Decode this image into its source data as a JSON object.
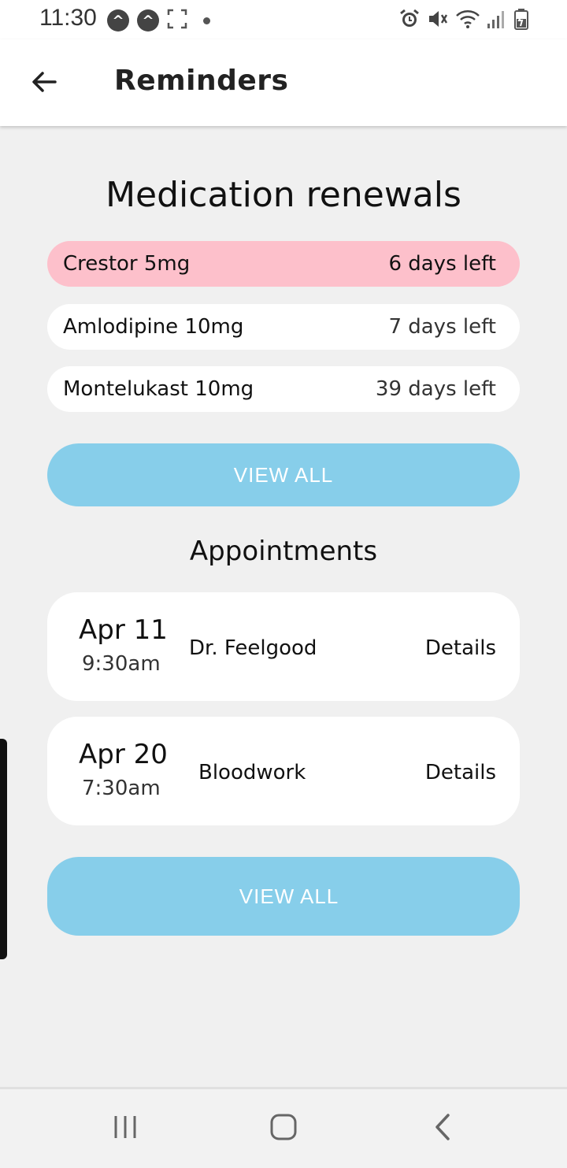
{
  "status": {
    "time": "11:30",
    "left_icons": [
      "a-badge-icon",
      "a-badge-icon",
      "screenshot-icon",
      "dot-icon"
    ],
    "right_icons": [
      "alarm-icon",
      "mute-icon",
      "wifi-icon",
      "signal-icon",
      "battery-icon"
    ]
  },
  "header": {
    "title": "Reminders"
  },
  "renewals": {
    "title": "Medication renewals",
    "items": [
      {
        "name": "Crestor 5mg",
        "days": "6 days left",
        "urgent": true
      },
      {
        "name": "Amlodipine 10mg",
        "days": "7 days left",
        "urgent": false
      },
      {
        "name": "Montelukast 10mg",
        "days": "39 days left",
        "urgent": false
      }
    ],
    "view_all_label": "VIEW ALL"
  },
  "appointments": {
    "title": "Appointments",
    "items": [
      {
        "date": "Apr 11",
        "time": "9:30am",
        "description": "Dr. Feelgood",
        "details_label": "Details"
      },
      {
        "date": "Apr 20",
        "time": "7:30am",
        "description": "Bloodwork",
        "details_label": "Details"
      }
    ],
    "view_all_label": "VIEW ALL"
  },
  "colors": {
    "urgent_row": "#fdc0cb",
    "button": "#87ceea",
    "background": "#f0f0f0"
  },
  "nav": {
    "buttons": [
      "recents-icon",
      "home-icon",
      "back-nav-icon"
    ]
  }
}
